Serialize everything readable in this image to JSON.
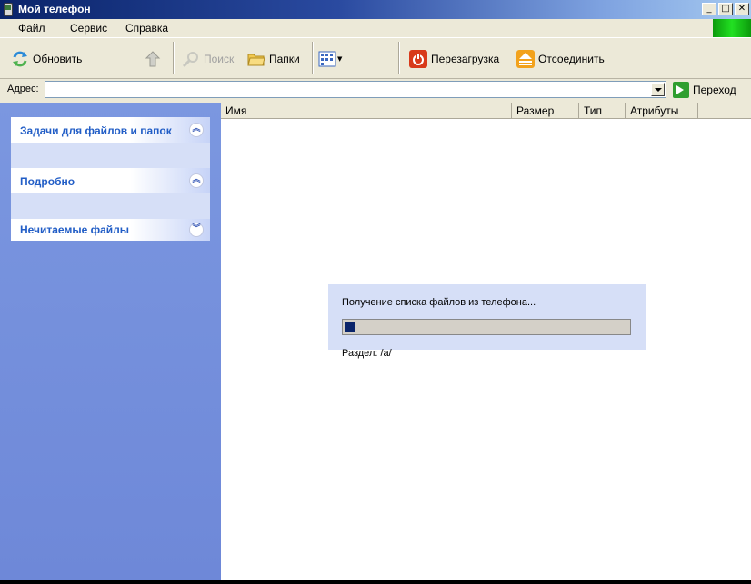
{
  "window": {
    "title": "Мой телефон"
  },
  "menubar": {
    "items": [
      "Файл",
      "Сервис",
      "Справка"
    ]
  },
  "toolbar": {
    "refresh_label": "Обновить",
    "search_label": "Поиск",
    "folders_label": "Папки",
    "restart_label": "Перезагрузка",
    "disconnect_label": "Отсоединить"
  },
  "addressbar": {
    "label": "Адрес:",
    "value": "",
    "go_label": "Переход"
  },
  "sidebar": {
    "panels": [
      {
        "label": "Задачи для файлов и папок",
        "state": "expanded"
      },
      {
        "label": "Подробно",
        "state": "expanded"
      },
      {
        "label": "Нечитаемые файлы",
        "state": "collapsed"
      }
    ]
  },
  "filelist": {
    "columns": [
      "Имя",
      "Размер",
      "Тип",
      "Атрибуты"
    ]
  },
  "progress": {
    "message": "Получение списка файлов из телефона...",
    "fraction": 0.04,
    "section_label": "Раздел: /a/"
  },
  "colors": {
    "title_bar": "#0a246a",
    "task_pane": "#7b97e0",
    "panel_header_text": "#215dc6",
    "progress_fill": "#0a246a"
  }
}
